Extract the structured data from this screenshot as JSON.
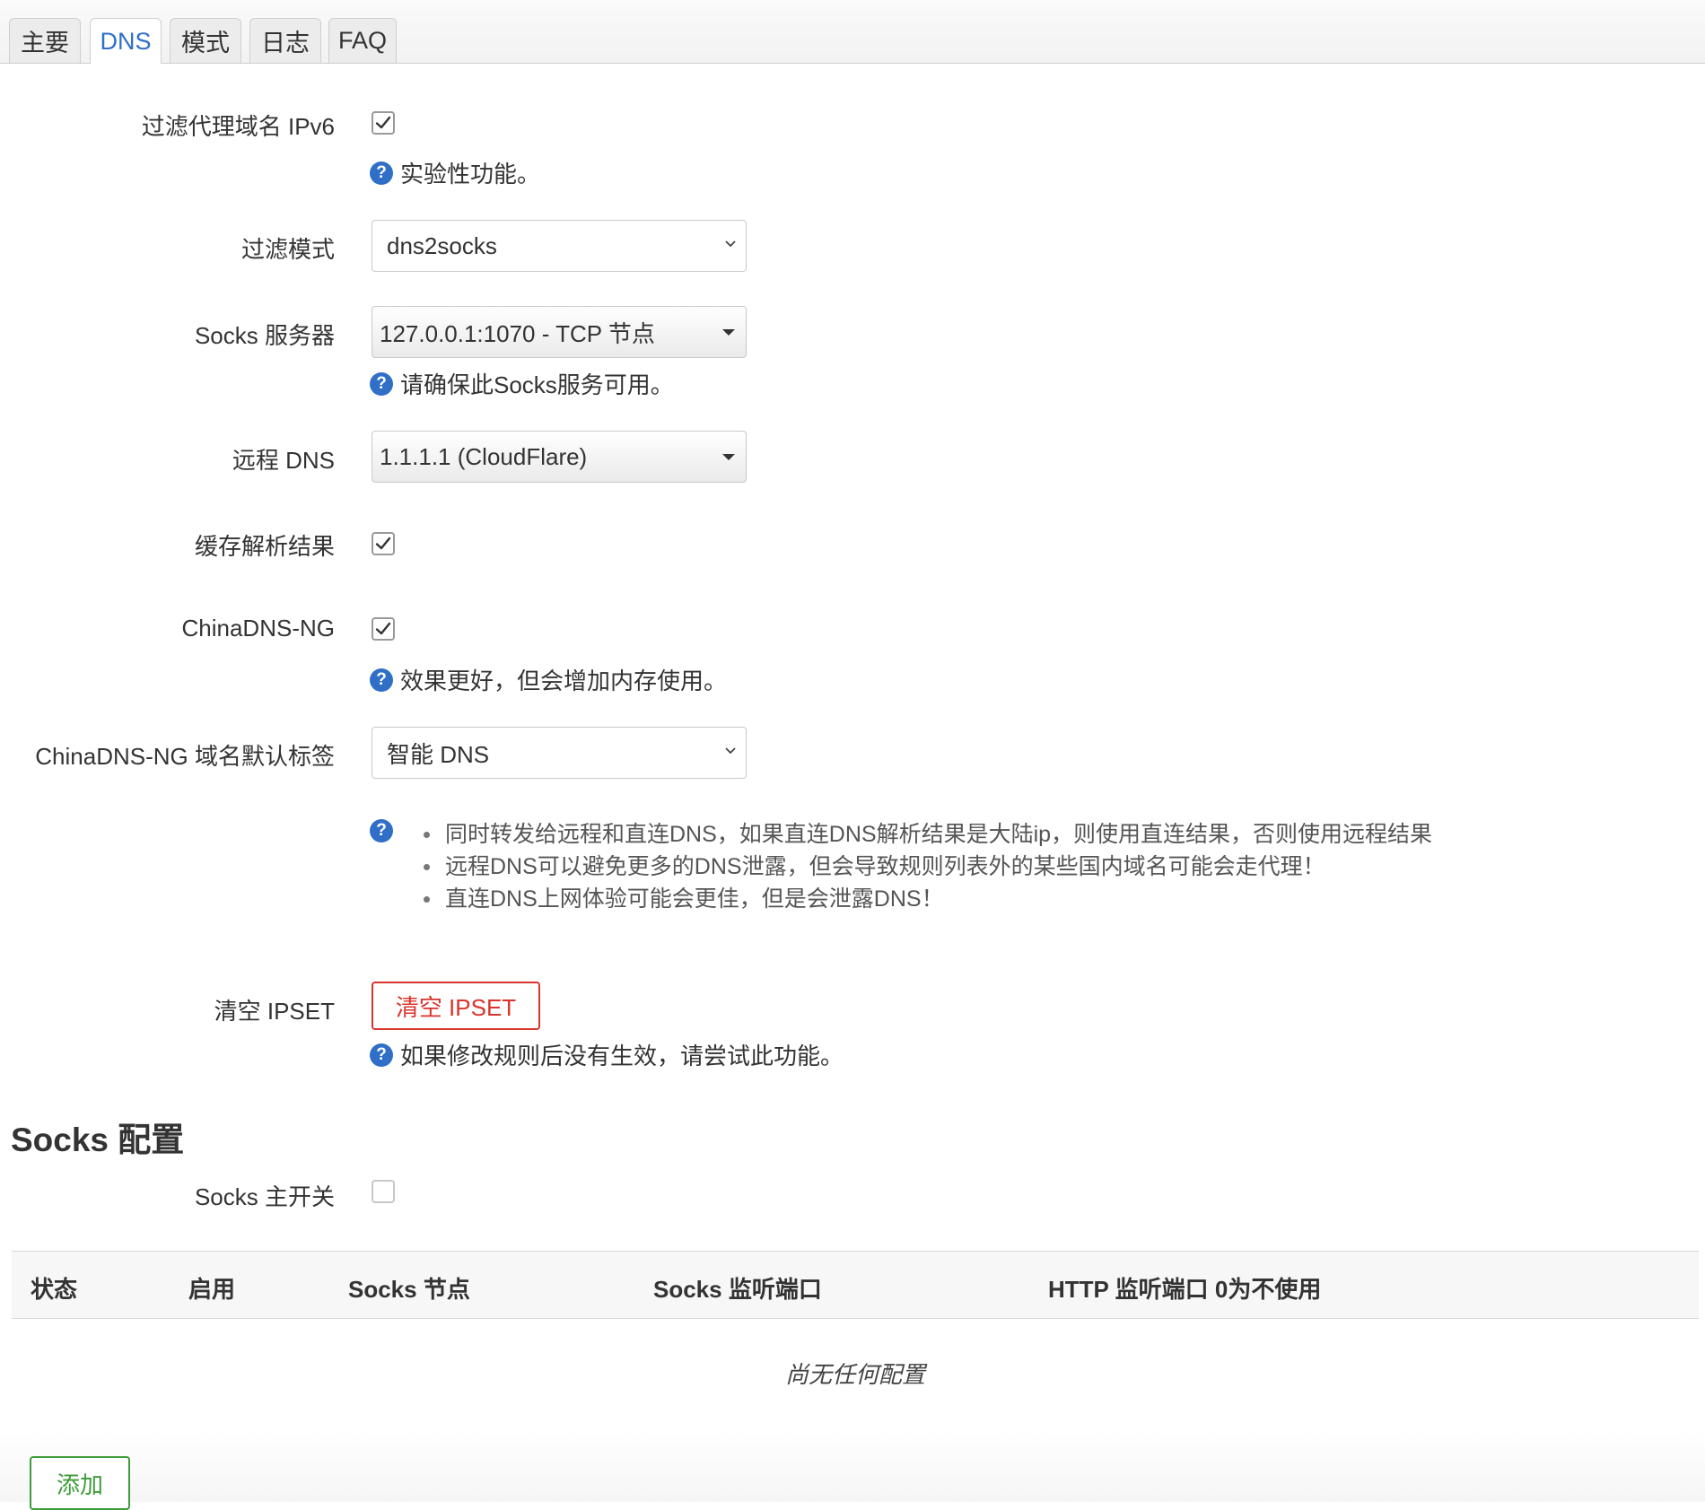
{
  "tabs": [
    {
      "label": "主要"
    },
    {
      "label": "DNS"
    },
    {
      "label": "模式"
    },
    {
      "label": "日志"
    },
    {
      "label": "FAQ"
    }
  ],
  "dns": {
    "filter_ipv6": {
      "label": "过滤代理域名 IPv6",
      "checked": true,
      "help": "实验性功能。"
    },
    "filter_mode": {
      "label": "过滤模式",
      "value": "dns2socks"
    },
    "socks_server": {
      "label": "Socks 服务器",
      "value": "127.0.0.1:1070 - TCP 节点",
      "help": "请确保此Socks服务可用。"
    },
    "remote_dns": {
      "label": "远程 DNS",
      "value": "1.1.1.1 (CloudFlare)"
    },
    "cache_results": {
      "label": "缓存解析结果",
      "checked": true
    },
    "chinadns_ng": {
      "label": "ChinaDNS-NG",
      "checked": true,
      "help": "效果更好，但会增加内存使用。"
    },
    "chinadns_ng_tag": {
      "label": "ChinaDNS-NG 域名默认标签",
      "value": "智能 DNS",
      "help_items": [
        "同时转发给远程和直连DNS，如果直连DNS解析结果是大陆ip，则使用直连结果，否则使用远程结果",
        "远程DNS可以避免更多的DNS泄露，但会导致规则列表外的某些国内域名可能会走代理！",
        "直连DNS上网体验可能会更佳，但是会泄露DNS！"
      ]
    },
    "clear_ipset": {
      "label": "清空 IPSET",
      "button": "清空 IPSET",
      "help": "如果修改规则后没有生效，请尝试此功能。"
    }
  },
  "socks": {
    "title": "Socks 配置",
    "master_switch": {
      "label": "Socks 主开关",
      "checked": false
    },
    "table": {
      "headers": [
        "状态",
        "启用",
        "Socks 节点",
        "Socks 监听端口",
        "HTTP 监听端口 0为不使用"
      ],
      "empty_text": "尚无任何配置"
    },
    "add_button": "添加"
  },
  "colors": {
    "accent": "#2f6fc7",
    "danger": "#d9342b",
    "success": "#3d9b3a"
  }
}
